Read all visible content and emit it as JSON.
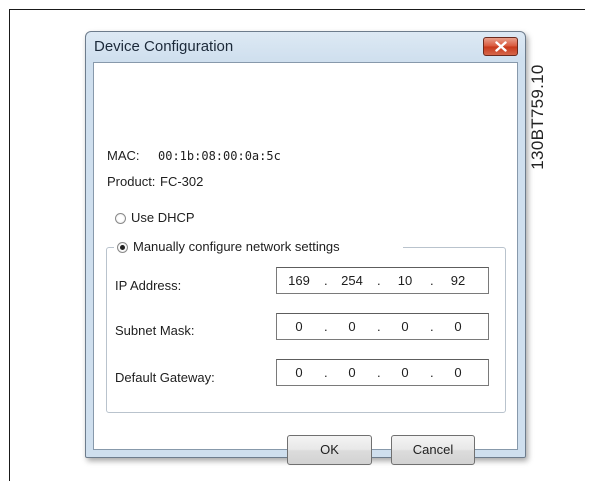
{
  "figure_id": "130BT759.10",
  "dialog": {
    "title": "Device Configuration",
    "close_icon": "close-x-icon"
  },
  "device": {
    "mac_label": "MAC:",
    "mac_value": "00:1b:08:00:0a:5c",
    "product_label": "Product:",
    "product_value": "FC-302"
  },
  "network": {
    "dhcp_label": "Use DHCP",
    "dhcp_selected": false,
    "manual_label": "Manually configure network settings",
    "manual_selected": true,
    "ip": {
      "label": "IP Address:",
      "octets": [
        "169",
        "254",
        "10",
        "92"
      ]
    },
    "subnet": {
      "label": "Subnet Mask:",
      "octets": [
        "0",
        "0",
        "0",
        "0"
      ]
    },
    "gateway": {
      "label": "Default Gateway:",
      "octets": [
        "0",
        "0",
        "0",
        "0"
      ]
    },
    "separator": "."
  },
  "buttons": {
    "ok_label": "OK",
    "cancel_label": "Cancel"
  },
  "colors": {
    "title_bar": "#cfdfee",
    "close_button": "#c7381a"
  }
}
